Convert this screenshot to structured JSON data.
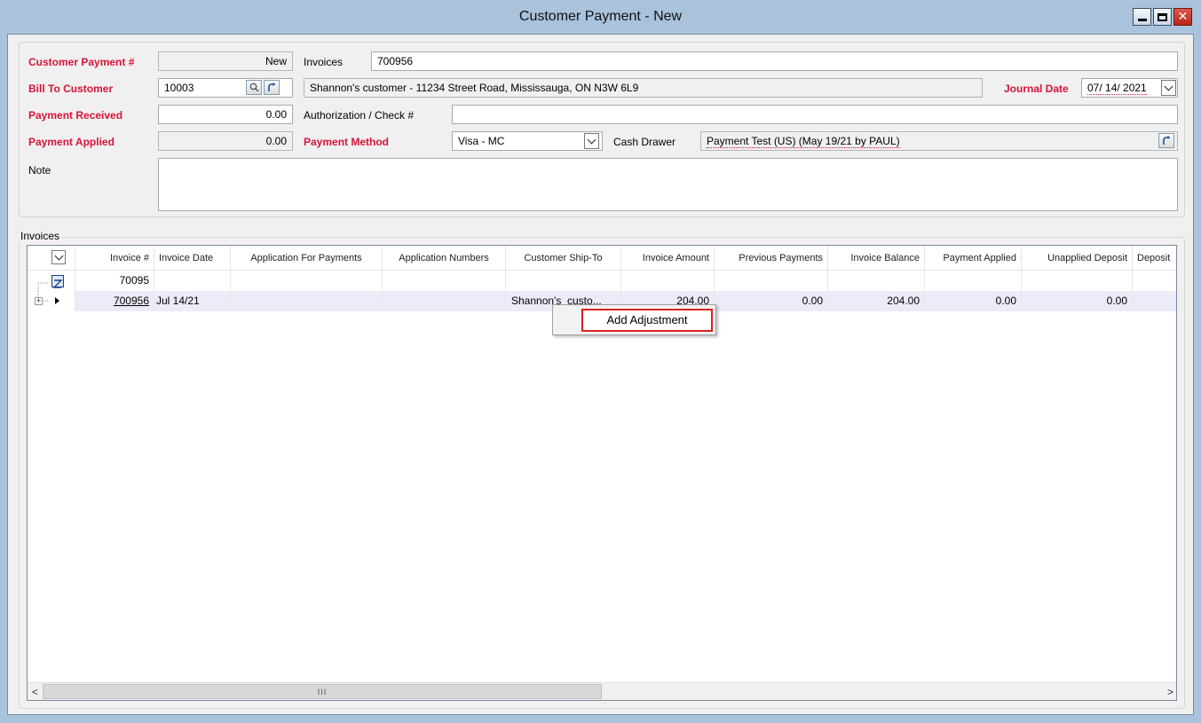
{
  "window": {
    "title": "Customer Payment - New",
    "close_glyph": "✕"
  },
  "form": {
    "customer_payment_label": "Customer Payment #",
    "customer_payment_value": "New",
    "invoices_label": "Invoices",
    "invoices_value": "700956",
    "bill_to_label": "Bill To Customer",
    "bill_to_value": "10003",
    "bill_to_address": "Shannon's customer - 11234 Street Road, Mississauga, ON  N3W 6L9",
    "journal_date_label": "Journal Date",
    "journal_date_value": "07/ 14/ 2021",
    "payment_received_label": "Payment Received",
    "payment_received_value": "0.00",
    "auth_label": "Authorization / Check #",
    "auth_value": "",
    "payment_applied_label": "Payment Applied",
    "payment_applied_value": "0.00",
    "payment_method_label": "Payment Method",
    "payment_method_value": "Visa - MC",
    "cash_drawer_label": "Cash Drawer",
    "cash_drawer_value": "Payment Test (US) (May 19/21 by PAUL)",
    "note_label": "Note",
    "note_value": ""
  },
  "grid": {
    "label": "Invoices",
    "columns": [
      "Invoice #",
      "Invoice Date",
      "Application For Payments",
      "Application Numbers",
      "Customer Ship-To",
      "Invoice Amount",
      "Previous Payments",
      "Invoice Balance",
      "Payment Applied",
      "Unapplied Deposit",
      "Deposit"
    ],
    "filter_row": {
      "invoice": "70095"
    },
    "rows": [
      {
        "invoice": "700956",
        "invoice_date": "Jul 14/21",
        "application_for_payments": "",
        "application_numbers": "",
        "ship_to": "Shannon's_custo...",
        "invoice_amount": "204.00",
        "previous_payments": "0.00",
        "invoice_balance": "204.00",
        "payment_applied": "0.00",
        "unapplied_deposit": "0.00",
        "deposit": ""
      }
    ],
    "scroll_thumb_glyph": "III",
    "scroll_left_glyph": "<",
    "scroll_right_glyph": ">"
  },
  "context_menu": {
    "items": [
      "Add Adjustment"
    ]
  },
  "colors": {
    "required_label": "#d7143a",
    "window_frame": "#a9c3dd",
    "selected_row": "#ececf8",
    "highlight_box": "#e02020"
  },
  "icons": {
    "lookup": "magnifier-icon",
    "link": "link-arrow-icon",
    "filter": "filter-icon",
    "dropdown": "chevron-down-icon",
    "expand": "expand-plus-icon",
    "row_pointer": "row-pointer-icon"
  }
}
